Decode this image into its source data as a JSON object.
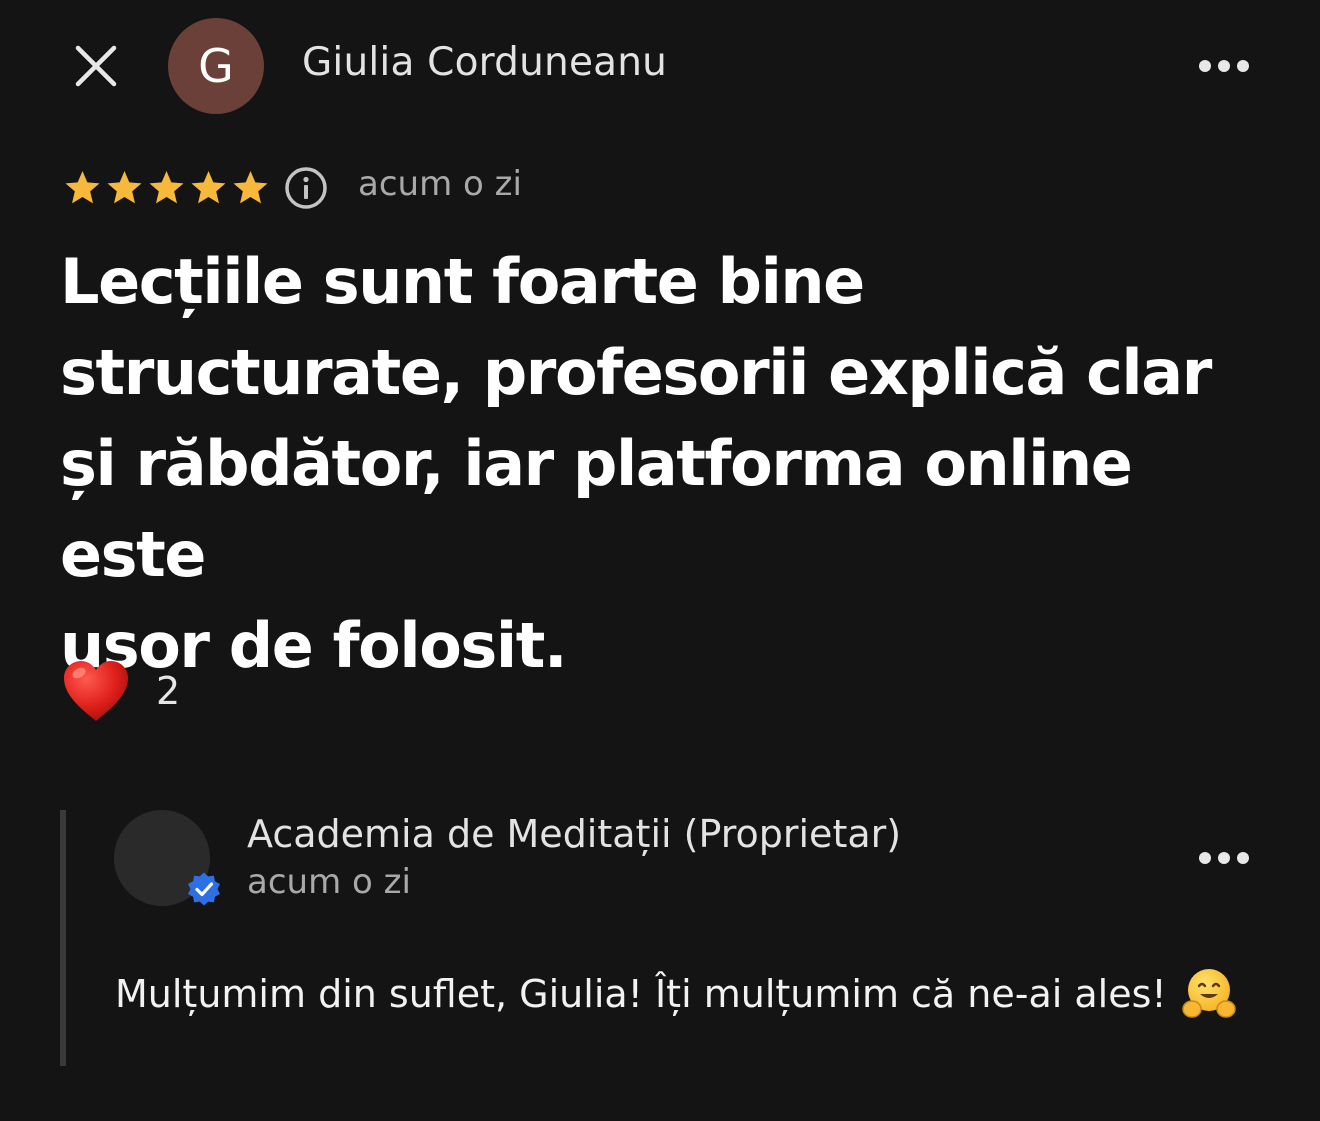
{
  "header": {
    "avatar_initial": "G",
    "avatar_color": "#6a4038",
    "author_name": "Giulia Corduneanu",
    "close_icon": "close-icon",
    "more_icon": "more-horizontal-icon"
  },
  "review": {
    "rating": 5,
    "rating_max": 5,
    "star_color": "#f6b93b",
    "star_icon": "star-icon",
    "info_icon": "info-icon",
    "timestamp": "acum o zi",
    "text_lines": [
      "Lecțiile sunt foarte bine",
      "structurate, profesorii explică clar",
      "și răbdător, iar platforma online este",
      "ușor de folosit."
    ]
  },
  "reaction": {
    "icon": "heart-icon",
    "count": "2"
  },
  "owner_reply": {
    "name": "Academia de Meditații (Proprietar)",
    "timestamp": "acum o zi",
    "verified_icon": "verified-badge-icon",
    "verified_color": "#2f6fe4",
    "text": "Mulțumim din suflet, Giulia! Îți mulțumim că ne-ai ales!",
    "emoji_icon": "hugging-face-icon",
    "more_icon": "more-horizontal-icon"
  }
}
